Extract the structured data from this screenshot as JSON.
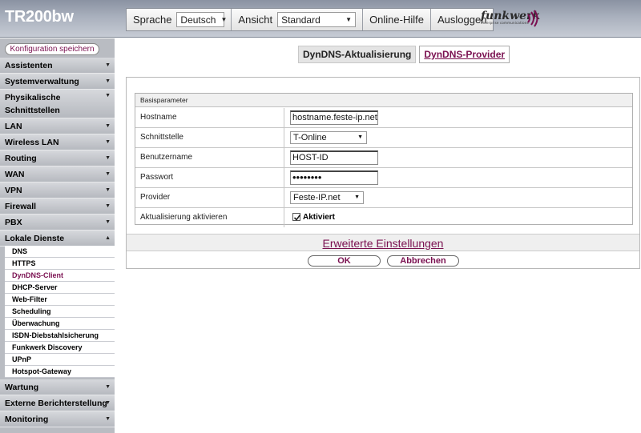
{
  "header": {
    "device": "TR200bw",
    "language_label": "Sprache",
    "language_value": "Deutsch",
    "view_label": "Ansicht",
    "view_value": "Standard",
    "help": "Online-Hilfe",
    "logout": "Ausloggen",
    "brand": "funkwerk",
    "brand_sub": "enterprise communications"
  },
  "sidebar": {
    "save": "Konfiguration speichern",
    "items": [
      "Assistenten",
      "Systemverwaltung",
      "Physikalische Schnittstellen",
      "LAN",
      "Wireless LAN",
      "Routing",
      "WAN",
      "VPN",
      "Firewall",
      "PBX",
      "Lokale Dienste",
      "Wartung",
      "Externe Berichterstellung",
      "Monitoring"
    ],
    "physical_line1": "Physikalische",
    "physical_line2": "Schnittstellen",
    "subitems": [
      "DNS",
      "HTTPS",
      "DynDNS-Client",
      "DHCP-Server",
      "Web-Filter",
      "Scheduling",
      "Überwachung",
      "ISDN-Diebstahlsicherung",
      "Funkwerk Discovery",
      "UPnP",
      "Hotspot-Gateway"
    ]
  },
  "tabs": {
    "active": "DynDNS-Aktualisierung",
    "provider": "DynDNS-Provider"
  },
  "form": {
    "legend": "Basisparameter",
    "hostname_label": "Hostname",
    "hostname_value": "hostname.feste-ip.net",
    "interface_label": "Schnittstelle",
    "interface_value": "T-Online",
    "user_label": "Benutzername",
    "user_value": "HOST-ID",
    "password_label": "Passwort",
    "password_value": "••••••••",
    "provider_label": "Provider",
    "provider_value": "Feste-IP.net",
    "enable_label": "Aktualisierung aktivieren",
    "enable_value": "Aktiviert"
  },
  "advanced": "Erweiterte Einstellungen",
  "buttons": {
    "ok": "OK",
    "cancel": "Abbrechen"
  }
}
